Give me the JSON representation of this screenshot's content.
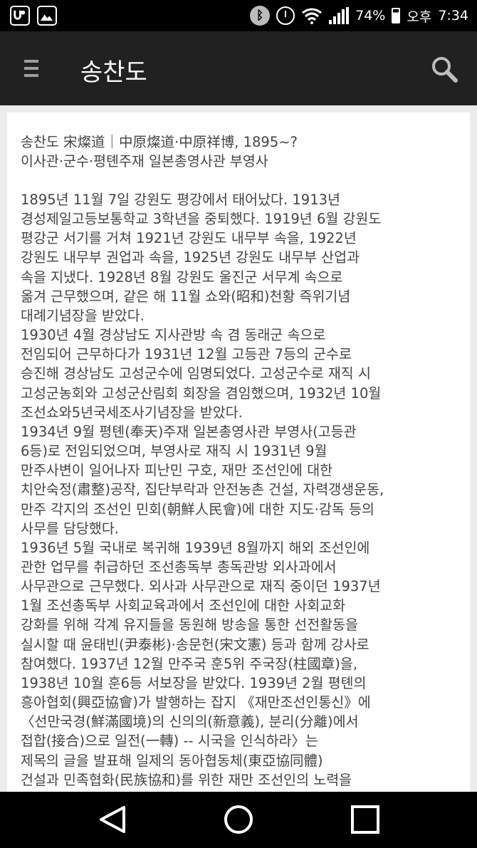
{
  "status_bar": {
    "battery": "74%",
    "ampm": "오후",
    "time": "7:34",
    "icons": [
      "app-notification-icon",
      "image-notification-icon",
      "bluetooth-icon",
      "alarm-icon",
      "wifi-icon",
      "signal-icon",
      "battery-icon"
    ]
  },
  "app_bar": {
    "title": "송찬도",
    "icons": [
      "menu-icon",
      "search-icon"
    ]
  },
  "entry": {
    "headline_line1": "송찬도 宋燦道｜中原燦道·中原祥博, 1895~?",
    "headline_line2": "이사관·군수·평톈주재 일본총영사관 부영사",
    "lines": [
      "1895년 11월 7일 강원도 평강에서 태어났다. 1913년",
      "경성제일고등보통학교 3학년을 중퇴했다. 1919년 6월 강원도",
      "평강군 서기를 거쳐 1921년 강원도 내무부 속을, 1922년",
      "강원도 내무부 권업과 속을, 1925년 강원도 내무부 산업과",
      "속을 지냈다. 1928년 8월 강원도 울진군 서무계 속으로",
      "옮겨 근무했으며, 같은 해 11월 쇼와(昭和)천황 즉위기념",
      "대례기념장을 받았다.",
      "1930년 4월 경상남도 지사관방 속 겸 동래군 속으로",
      "전임되어 근무하다가 1931년 12월 고등관 7등의 군수로",
      "승진해 경상남도 고성군수에 임명되었다. 고성군수로 재직 시",
      "고성군농회와 고성군산림회 회장을 겸임했으며, 1932년 10월",
      "조선쇼와5년국세조사기념장을 받았다.",
      "1934년 9월 평톈(奉天)주재 일본총영사관 부영사(고등관",
      "6등)로 전임되었으며, 부영사로 재직 시 1931년 9월",
      "만주사변이 일어나자 피난민 구호, 재만 조선인에 대한",
      "치안숙정(肅整)공작, 집단부락과 안전농촌 건설, 자력갱생운동,",
      "만주 각지의 조선인 민회(朝鮮人民會)에 대한 지도·감독 등의",
      "사무를 담당했다.",
      "1936년 5월 국내로 복귀해 1939년 8월까지 해외 조선인에",
      "관한 업무를 취급하던 조선총독부 총독관방 외사과에서",
      "사무관으로 근무했다. 외사과 사무관으로 재직 중이던 1937년",
      "1월 조선총독부 사회교육과에서 조선인에 대한 사회교화",
      "강화를 위해 각계 유지들을 동원해 방송을 통한 선전활동을",
      "실시할 때 윤태빈(尹泰彬)·송문헌(宋文憲) 등과 함께 강사로",
      "참여했다. 1937년 12월 만주국 훈5위 주국장(柱國章)을,",
      "1938년 10월 훈6등 서보장을 받았다. 1939년 2월 평톈의",
      "흥아협회(興亞協會)가 발행하는 잡지 《재만조선인통신》에",
      "〈선만국경(鮮滿國境)의 신의의(新意義), 분리(分離)에서",
      "접합(接合)으로 일전(一轉) -- 시국을 인식하라〉는",
      "제목의 글을 발표해 일제의 동아협동체(東亞協同體)",
      "건설과 민족협화(民族協和)를 위한 재만 조선인의 노력을"
    ]
  },
  "nav_bar": {
    "buttons": [
      "back-icon",
      "home-icon",
      "recents-icon"
    ]
  },
  "colors": {
    "status_bar": "#000000",
    "app_bar": "#212121",
    "content_bg": "#ececec",
    "card_bg": "#ffffff",
    "text": "#444444"
  }
}
